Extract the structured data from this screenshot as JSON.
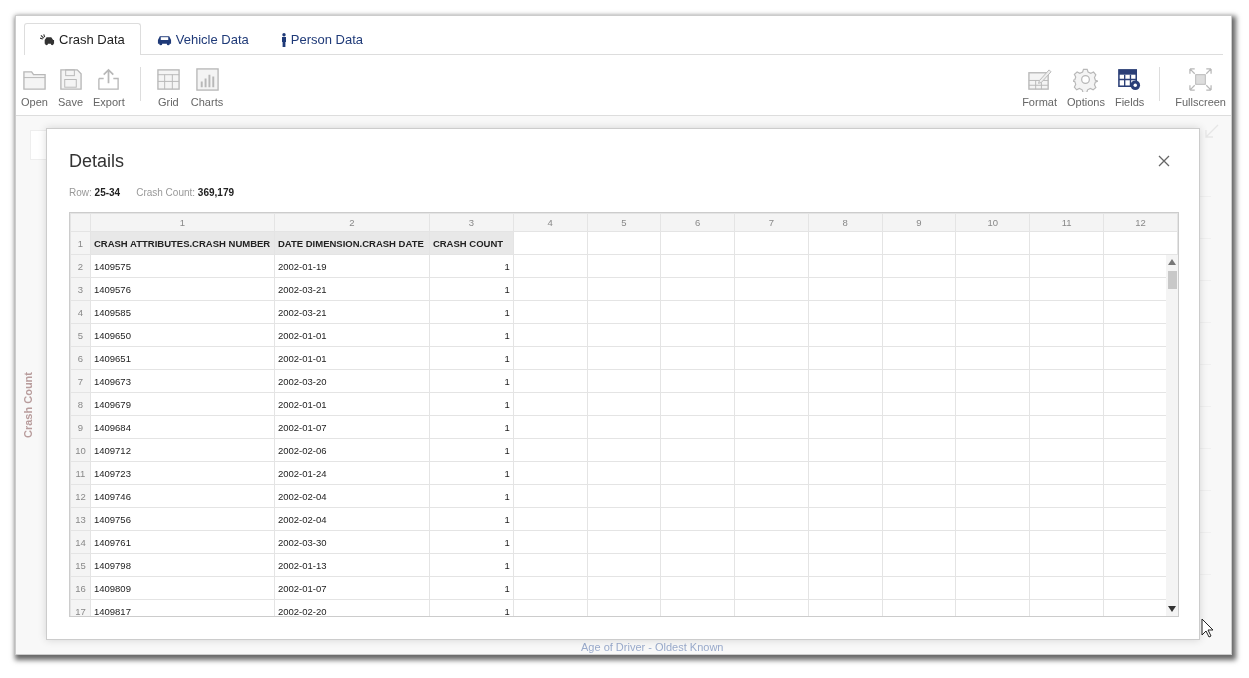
{
  "tabs": [
    {
      "label": "Crash Data",
      "kind": "crash",
      "selected": true
    },
    {
      "label": "Vehicle Data",
      "kind": "vehicle",
      "selected": false
    },
    {
      "label": "Person Data",
      "kind": "person",
      "selected": false
    }
  ],
  "toolbar_left": [
    {
      "label": "Open",
      "kind": "folder"
    },
    {
      "label": "Save",
      "kind": "save"
    },
    {
      "label": "Export",
      "kind": "export"
    },
    {
      "kind": "separator"
    },
    {
      "label": "Grid",
      "kind": "grid"
    },
    {
      "label": "Charts",
      "kind": "charts"
    }
  ],
  "toolbar_right": [
    {
      "label": "Format",
      "kind": "format"
    },
    {
      "label": "Options",
      "kind": "options"
    },
    {
      "label": "Fields",
      "kind": "fields",
      "selected": true
    },
    {
      "kind": "separator"
    },
    {
      "label": "Fullscreen",
      "kind": "fullscreen"
    }
  ],
  "background_chart": {
    "ylabel": "Crash Count",
    "xlabel": "Age of Driver - Oldest Known"
  },
  "dialog": {
    "title": "Details",
    "info": [
      {
        "label": "Row:",
        "value": "25-34"
      },
      {
        "label": "Crash Count:",
        "value": "369,179"
      }
    ],
    "grid": {
      "column_labels": [
        "1",
        "2",
        "3",
        "4",
        "5",
        "6",
        "7",
        "8",
        "9",
        "10",
        "11",
        "12"
      ],
      "header_row": {
        "number": "1",
        "cells": [
          "CRASH ATTRIBUTES.CRASH NUMBER",
          "DATE DIMENSION.CRASH DATE",
          "CRASH COUNT"
        ]
      },
      "rows": [
        {
          "number": "2",
          "cells": [
            "1409575",
            "2002-01-19",
            "1"
          ]
        },
        {
          "number": "3",
          "cells": [
            "1409576",
            "2002-03-21",
            "1"
          ]
        },
        {
          "number": "4",
          "cells": [
            "1409585",
            "2002-03-21",
            "1"
          ]
        },
        {
          "number": "5",
          "cells": [
            "1409650",
            "2002-01-01",
            "1"
          ]
        },
        {
          "number": "6",
          "cells": [
            "1409651",
            "2002-01-01",
            "1"
          ]
        },
        {
          "number": "7",
          "cells": [
            "1409673",
            "2002-03-20",
            "1"
          ]
        },
        {
          "number": "8",
          "cells": [
            "1409679",
            "2002-01-01",
            "1"
          ]
        },
        {
          "number": "9",
          "cells": [
            "1409684",
            "2002-01-07",
            "1"
          ]
        },
        {
          "number": "10",
          "cells": [
            "1409712",
            "2002-02-06",
            "1"
          ]
        },
        {
          "number": "11",
          "cells": [
            "1409723",
            "2002-01-24",
            "1"
          ]
        },
        {
          "number": "12",
          "cells": [
            "1409746",
            "2002-02-04",
            "1"
          ]
        },
        {
          "number": "13",
          "cells": [
            "1409756",
            "2002-02-04",
            "1"
          ]
        },
        {
          "number": "14",
          "cells": [
            "1409761",
            "2002-03-30",
            "1"
          ]
        },
        {
          "number": "15",
          "cells": [
            "1409798",
            "2002-01-13",
            "1"
          ]
        },
        {
          "number": "16",
          "cells": [
            "1409809",
            "2002-01-07",
            "1"
          ]
        },
        {
          "number": "17",
          "cells": [
            "1409817",
            "2002-02-20",
            "1"
          ]
        }
      ]
    }
  }
}
